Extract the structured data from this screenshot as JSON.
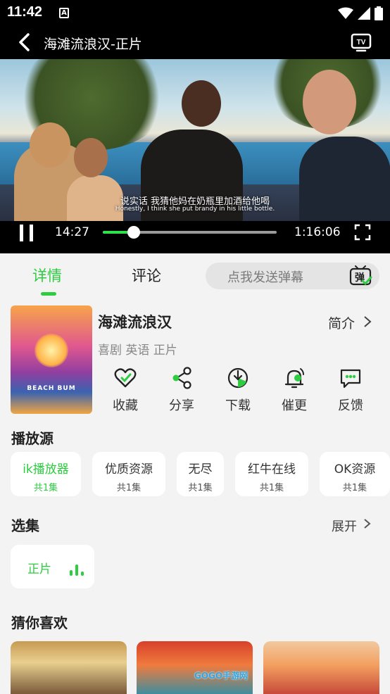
{
  "status_bar": {
    "time": "11:42",
    "notification_icon": "A",
    "icons": [
      "wifi-icon",
      "signal-icon",
      "battery-icon"
    ]
  },
  "title_bar": {
    "title": "海滩流浪汉-正片",
    "icons": [
      "back-arrow-icon",
      "tv-cast-icon"
    ]
  },
  "player": {
    "subtitle_zh": "说实话  我猜他妈在奶瓶里加酒给他喝",
    "subtitle_en": "Honestly, I think she put brandy in his little bottle.",
    "current_time": "14:27",
    "duration": "1:16:06",
    "progress": 0.1774,
    "icons": [
      "pause-icon",
      "fullscreen-icon"
    ]
  },
  "tabs": {
    "items": [
      {
        "label": "详情",
        "active": true
      },
      {
        "label": "评论",
        "active": false
      }
    ],
    "danmu_placeholder": "点我发送弹幕",
    "danmu_icon_text": "弹"
  },
  "details": {
    "poster_text": "BEACH BUM",
    "title": "海滩流浪汉",
    "intro_label": "简介",
    "meta": "喜剧 英语 正片",
    "actions": [
      {
        "label": "收藏",
        "icon": "heart-icon"
      },
      {
        "label": "分享",
        "icon": "share-icon"
      },
      {
        "label": "下载",
        "icon": "download-icon"
      },
      {
        "label": "催更",
        "icon": "bell-icon"
      },
      {
        "label": "反馈",
        "icon": "feedback-icon"
      }
    ]
  },
  "sources": {
    "title": "播放源",
    "items": [
      {
        "name": "ik播放器",
        "count": "共1集",
        "active": true
      },
      {
        "name": "优质资源",
        "count": "共1集",
        "active": false
      },
      {
        "name": "无尽",
        "count": "共1集",
        "active": false
      },
      {
        "name": "红牛在线",
        "count": "共1集",
        "active": false
      },
      {
        "name": "OK资源",
        "count": "共1集",
        "active": false
      }
    ]
  },
  "episodes": {
    "title": "选集",
    "expand_label": "展开",
    "items": [
      {
        "label": "正片",
        "playing": true
      }
    ]
  },
  "recommend": {
    "title": "猜你喜欢",
    "watermark": "GOGO手游网"
  },
  "colors": {
    "accent": "#2ecc40",
    "background": "#f3f3f3",
    "player_bar": "#000000"
  }
}
